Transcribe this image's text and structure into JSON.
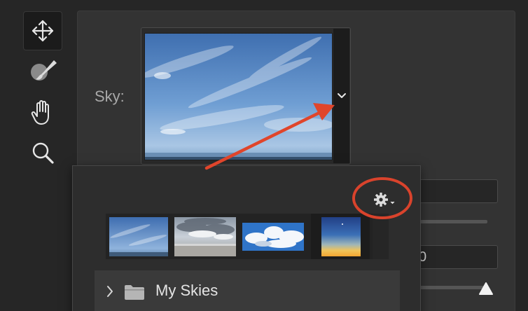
{
  "sky_panel": {
    "sky_label": "Sky:"
  },
  "controls": {
    "field_b_partial_value": "0"
  },
  "sky_presets": {
    "folder_label": "My Skies",
    "thumbnails": [
      "blue-sky-wispy-clouds",
      "cloudy-sky-over-water",
      "blue-sky-puffy-clouds",
      "sunset-gradient-sky"
    ]
  },
  "icons": {
    "tools": [
      "move-icon",
      "sky-brush-icon",
      "hand-icon",
      "zoom-icon"
    ],
    "menu": "gear-icon",
    "dropdown": "chevron-down-icon",
    "folder": "folder-icon",
    "expand": "chevron-right-icon"
  },
  "annotation_colors": {
    "arrow": "#e0452b",
    "circle": "#d9432c"
  }
}
